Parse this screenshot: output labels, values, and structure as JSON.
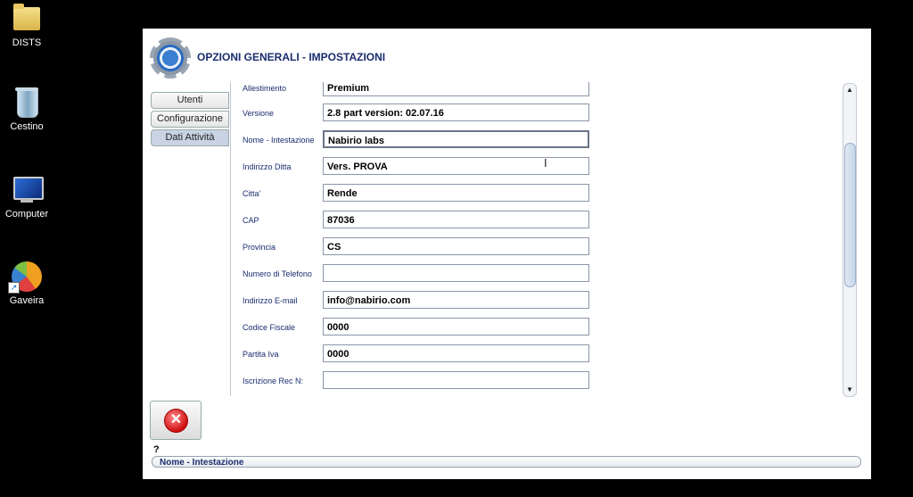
{
  "desktop": {
    "icons": [
      {
        "label": "DISTS"
      },
      {
        "label": "Cestino"
      },
      {
        "label": "Computer"
      },
      {
        "label": "Gaveira"
      }
    ]
  },
  "window": {
    "title": "OPZIONI GENERALI - IMPOSTAZIONI",
    "tabs": [
      {
        "label": "Utenti"
      },
      {
        "label": "Configurazione"
      },
      {
        "label": "Dati Attività"
      }
    ],
    "fields": [
      {
        "label": "Allestimento",
        "value": "Premium"
      },
      {
        "label": "Versione",
        "value": "2.8 part version: 02.07.16"
      },
      {
        "label": "Nome - Intestazione",
        "value": "Nabirio labs"
      },
      {
        "label": "Indirizzo Ditta",
        "value": "Vers. PROVA"
      },
      {
        "label": "Citta'",
        "value": "Rende"
      },
      {
        "label": "CAP",
        "value": "87036"
      },
      {
        "label": "Provincia",
        "value": "CS"
      },
      {
        "label": "Numero di Telefono",
        "value": ""
      },
      {
        "label": "Indirizzo E-mail",
        "value": "info@nabirio.com"
      },
      {
        "label": "Codice Fiscale",
        "value": "0000"
      },
      {
        "label": "Partita Iva",
        "value": "0000"
      },
      {
        "label": "Iscrizione Rec N:",
        "value": ""
      }
    ],
    "scroll_up": "▲",
    "scroll_down": "▼",
    "close_symbol": "✕",
    "help_mark": "?",
    "status_text": "Nome - Intestazione"
  }
}
